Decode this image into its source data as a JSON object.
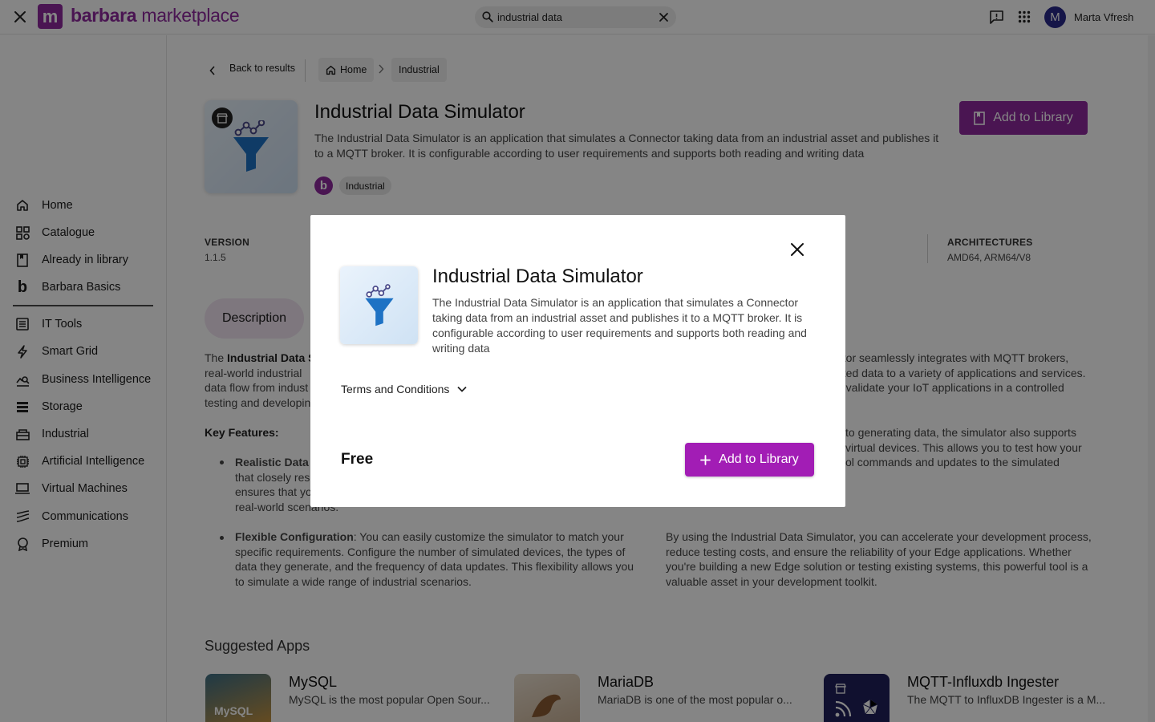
{
  "topbar": {
    "brand_bold": "barbara",
    "brand_rest": " marketplace",
    "logo_letter": "m",
    "search_value": "industrial data",
    "user_initial": "M",
    "user_name": "Marta Vfresh"
  },
  "sidebar": {
    "items": [
      {
        "label": "Home",
        "icon": "home-icon"
      },
      {
        "label": "Catalogue",
        "icon": "grid-icon"
      },
      {
        "label": "Already in library",
        "icon": "bookmark-icon"
      },
      {
        "label": "Barbara Basics",
        "icon": "barbara-b-icon"
      },
      {
        "label": "IT Tools",
        "icon": "list-icon"
      },
      {
        "label": "Smart Grid",
        "icon": "bolt-icon"
      },
      {
        "label": "Business Intelligence",
        "icon": "chart-search-icon"
      },
      {
        "label": "Storage",
        "icon": "storage-icon"
      },
      {
        "label": "Industrial",
        "icon": "factory-icon"
      },
      {
        "label": "Artificial Intelligence",
        "icon": "chip-icon"
      },
      {
        "label": "Virtual Machines",
        "icon": "laptop-icon"
      },
      {
        "label": "Communications",
        "icon": "signal-icon"
      },
      {
        "label": "Premium",
        "icon": "badge-icon"
      }
    ]
  },
  "breadcrumb": {
    "back_label": "Back to results",
    "home_label": "Home",
    "category_label": "Industrial"
  },
  "app": {
    "title": "Industrial Data Simulator",
    "description": "The Industrial Data Simulator is an application that simulates a Connector taking data from an industrial asset and publishes it to a MQTT broker. It is configurable according to user requirements and supports both reading and writing data",
    "publisher_initial": "b",
    "tag": "Industrial",
    "add_label": "Add to Library",
    "version_label": "VERSION",
    "version_value": "1.1.5",
    "arch_label": "ARCHITECTURES",
    "arch_value": "AMD64, ARM64/V8",
    "tab_description": "Description"
  },
  "body": {
    "p1_prefix": "The ",
    "p1_bold": "Industrial Data S",
    "p1_line2": "real-world industrial",
    "p1_line3": "data flow from indust",
    "p1_line4": "testing and developin",
    "key_features": "Key Features:",
    "b1_bold": "Realistic Data",
    "b1_line2": "that closely res",
    "b1_line3": "ensures that yo",
    "b1_line4": "real-world scenarios.",
    "b2_bold": "Flexible Configuration",
    "b2_line1": ": You can easily customize the simulator to match your",
    "b2_line2": "specific requirements. Configure the number of simulated devices, the types of",
    "b2_line3": "data they generate, and the frequency of data updates. This flexibility allows you",
    "b2_line4": "to simulate a wide range of industrial scenarios.",
    "r1_line1": "ator seamlessly integrates with MQTT brokers,",
    "r1_line2": "ated data to a variety of applications and services.",
    "r1_line3": "d validate your IoT applications in a controlled",
    "r2_line1": "to generating data, the simulator also supports",
    "r2_line2": "virtual devices. This allows you to test how your",
    "r2_line3": "ol commands and updates to the simulated",
    "r3_line1": "By using the Industrial Data Simulator, you can accelerate your development process,",
    "r3_line2": "reduce testing costs, and ensure the reliability of your Edge applications. Whether",
    "r3_line3": "you're building a new Edge solution or testing existing systems, this powerful tool is a",
    "r3_line4": "valuable asset in your development toolkit."
  },
  "suggested": {
    "heading": "Suggested Apps",
    "apps": [
      {
        "name": "MySQL",
        "desc": "MySQL is the most popular Open Sour...",
        "tile_text": "MySQL"
      },
      {
        "name": "MariaDB",
        "desc": "MariaDB is one of the most popular o..."
      },
      {
        "name": "MQTT-Influxdb Ingester",
        "desc": "The MQTT to InfluxDB Ingester is a M..."
      }
    ]
  },
  "modal": {
    "title": "Industrial Data Simulator",
    "description": "The Industrial Data Simulator is an application that simulates a Connector taking data from an industrial asset and publishes it to a MQTT broker. It is configurable according to user requirements and supports both reading and writing data",
    "terms_label": "Terms and Conditions",
    "price": "Free",
    "add_label": "Add to Library"
  },
  "colors": {
    "brand": "#8e2a9e",
    "button": "#a21db5"
  }
}
